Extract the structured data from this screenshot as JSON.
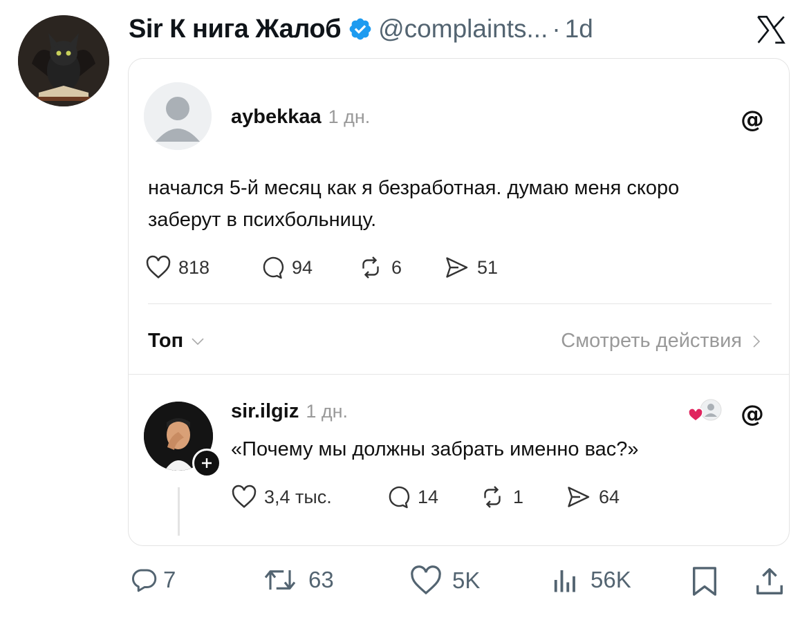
{
  "tweet": {
    "author_name": "Sir К нига Жалоб",
    "handle": "@complaints...",
    "separator": "·",
    "time": "1d",
    "actions": {
      "replies": "7",
      "reposts": "63",
      "likes": "5K",
      "views": "56K"
    }
  },
  "threads_post": {
    "username": "aybekkaa",
    "time": "1 дн.",
    "text": "начался 5-й месяц как я безработная. думаю меня скоро заберут в психбольницу.",
    "stats": {
      "likes": "818",
      "replies": "94",
      "reposts": "6",
      "shares": "51"
    },
    "sort_label": "Топ",
    "view_activity": "Смотреть действия"
  },
  "threads_reply": {
    "username": "sir.ilgiz",
    "time": "1 дн.",
    "text": "«Почему мы должны забрать именно вас?»",
    "stats": {
      "likes": "3,4 тыс.",
      "replies": "14",
      "reposts": "1",
      "shares": "64"
    }
  },
  "icons": {
    "verified": "verified-badge-icon",
    "x_logo": "x-logo-icon",
    "threads": "threads-logo-icon",
    "brand_blue": "#1d9bf0",
    "like_red": "#e0245e"
  }
}
